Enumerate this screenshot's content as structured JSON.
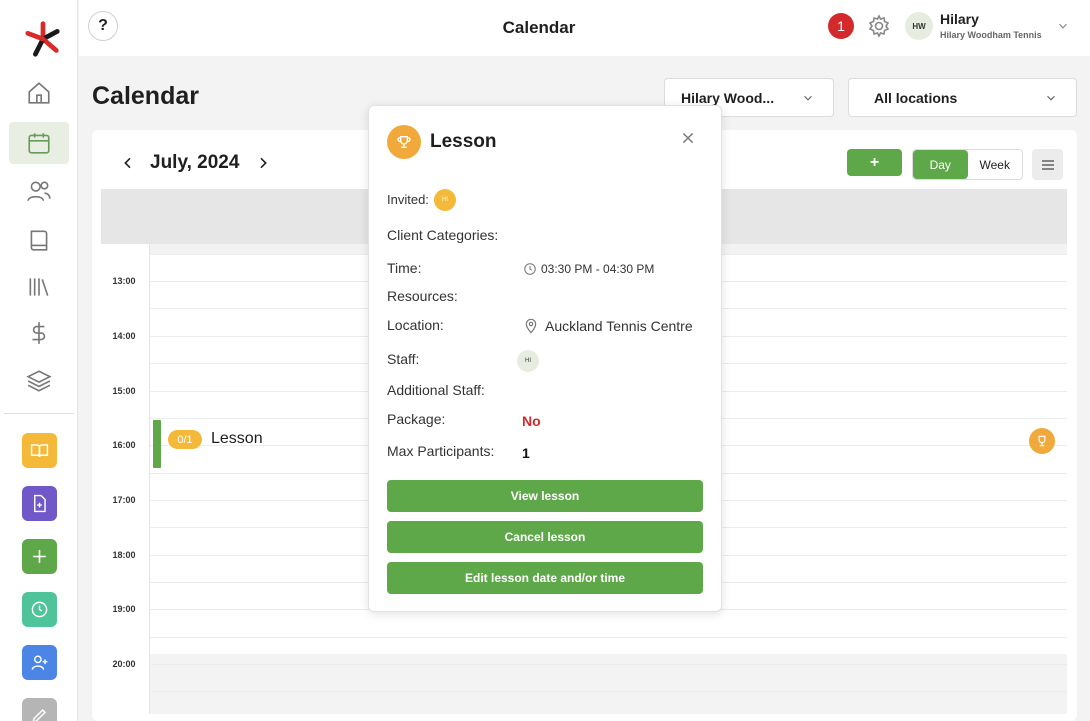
{
  "header": {
    "help": "?",
    "title": "Calendar",
    "notifications": "1",
    "user": {
      "initials": "HW",
      "name": "Hilary",
      "org": "Hilary Woodham Tennis"
    }
  },
  "sidebar": {
    "items": [
      {
        "icon": "home-icon"
      },
      {
        "icon": "calendar-icon",
        "active": true
      },
      {
        "icon": "users-icon"
      },
      {
        "icon": "book-icon"
      },
      {
        "icon": "library-icon"
      },
      {
        "icon": "dollar-icon"
      },
      {
        "icon": "layers-icon"
      }
    ],
    "quick_actions": [
      {
        "icon": "open-book-icon",
        "color": "#f5b93a"
      },
      {
        "icon": "add-document-icon",
        "color": "#7158c9"
      },
      {
        "icon": "plus-icon",
        "color": "#5fa84a"
      },
      {
        "icon": "clock-icon",
        "color": "#4fc39a"
      },
      {
        "icon": "add-user-icon",
        "color": "#4b86e6"
      },
      {
        "icon": "edit-icon",
        "color": "#b5b5b5"
      }
    ]
  },
  "main": {
    "title": "Calendar",
    "staff_select": "Hilary Wood...",
    "location_select": "All locations",
    "month": "July, 2024",
    "add_label": "+",
    "view_day": "Day",
    "view_week": "Week",
    "times": [
      "13:00",
      "14:00",
      "15:00",
      "16:00",
      "17:00",
      "18:00",
      "19:00",
      "20:00"
    ],
    "event": {
      "count": "0/1",
      "title": "Lesson"
    }
  },
  "popup": {
    "title": "Lesson",
    "invited_label": "Invited:",
    "invited_initials": "HI",
    "client_categories_label": "Client Categories:",
    "time_label": "Time:",
    "time_value": "03:30 PM - 04:30 PM",
    "resources_label": "Resources:",
    "location_label": "Location:",
    "location_value": "Auckland Tennis Centre",
    "staff_label": "Staff:",
    "staff_initials": "HI",
    "additional_staff_label": "Additional Staff:",
    "package_label": "Package:",
    "package_value": "No",
    "max_label": "Max Participants:",
    "max_value": "1",
    "btn_view": "View lesson",
    "btn_cancel": "Cancel lesson",
    "btn_edit": "Edit lesson date and/or time"
  },
  "colors": {
    "accent": "#5fa84a",
    "lesson": "#f0a93a",
    "alert": "#d32b2b"
  }
}
